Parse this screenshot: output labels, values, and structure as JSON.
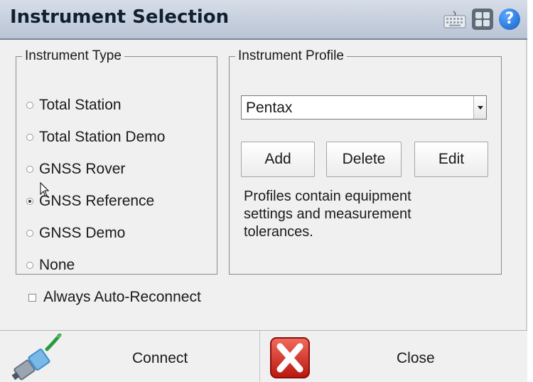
{
  "window": {
    "title": "Instrument Selection"
  },
  "title_icons": [
    "keyboard-icon",
    "grid-icon",
    "help-icon"
  ],
  "help_glyph": "?",
  "instrument_type": {
    "legend": "Instrument Type",
    "options": [
      {
        "label": "Total Station",
        "selected": false
      },
      {
        "label": "Total Station Demo",
        "selected": false
      },
      {
        "label": "GNSS Rover",
        "selected": false
      },
      {
        "label": "GNSS Reference",
        "selected": true
      },
      {
        "label": "GNSS Demo",
        "selected": false
      },
      {
        "label": "None",
        "selected": false
      }
    ]
  },
  "instrument_profile": {
    "legend": "Instrument Profile",
    "selected": "Pentax",
    "buttons": {
      "add": "Add",
      "delete": "Delete",
      "edit": "Edit"
    },
    "description": "Profiles contain equipment settings and measurement tolerances."
  },
  "auto_reconnect": {
    "label": "Always Auto-Reconnect",
    "checked": false
  },
  "footer": {
    "connect_label": "Connect",
    "close_label": "Close"
  },
  "colors": {
    "titlebar": "#c4cdda",
    "close_icon_red": "#d9261c",
    "help_blue": "#1f6fd8"
  }
}
